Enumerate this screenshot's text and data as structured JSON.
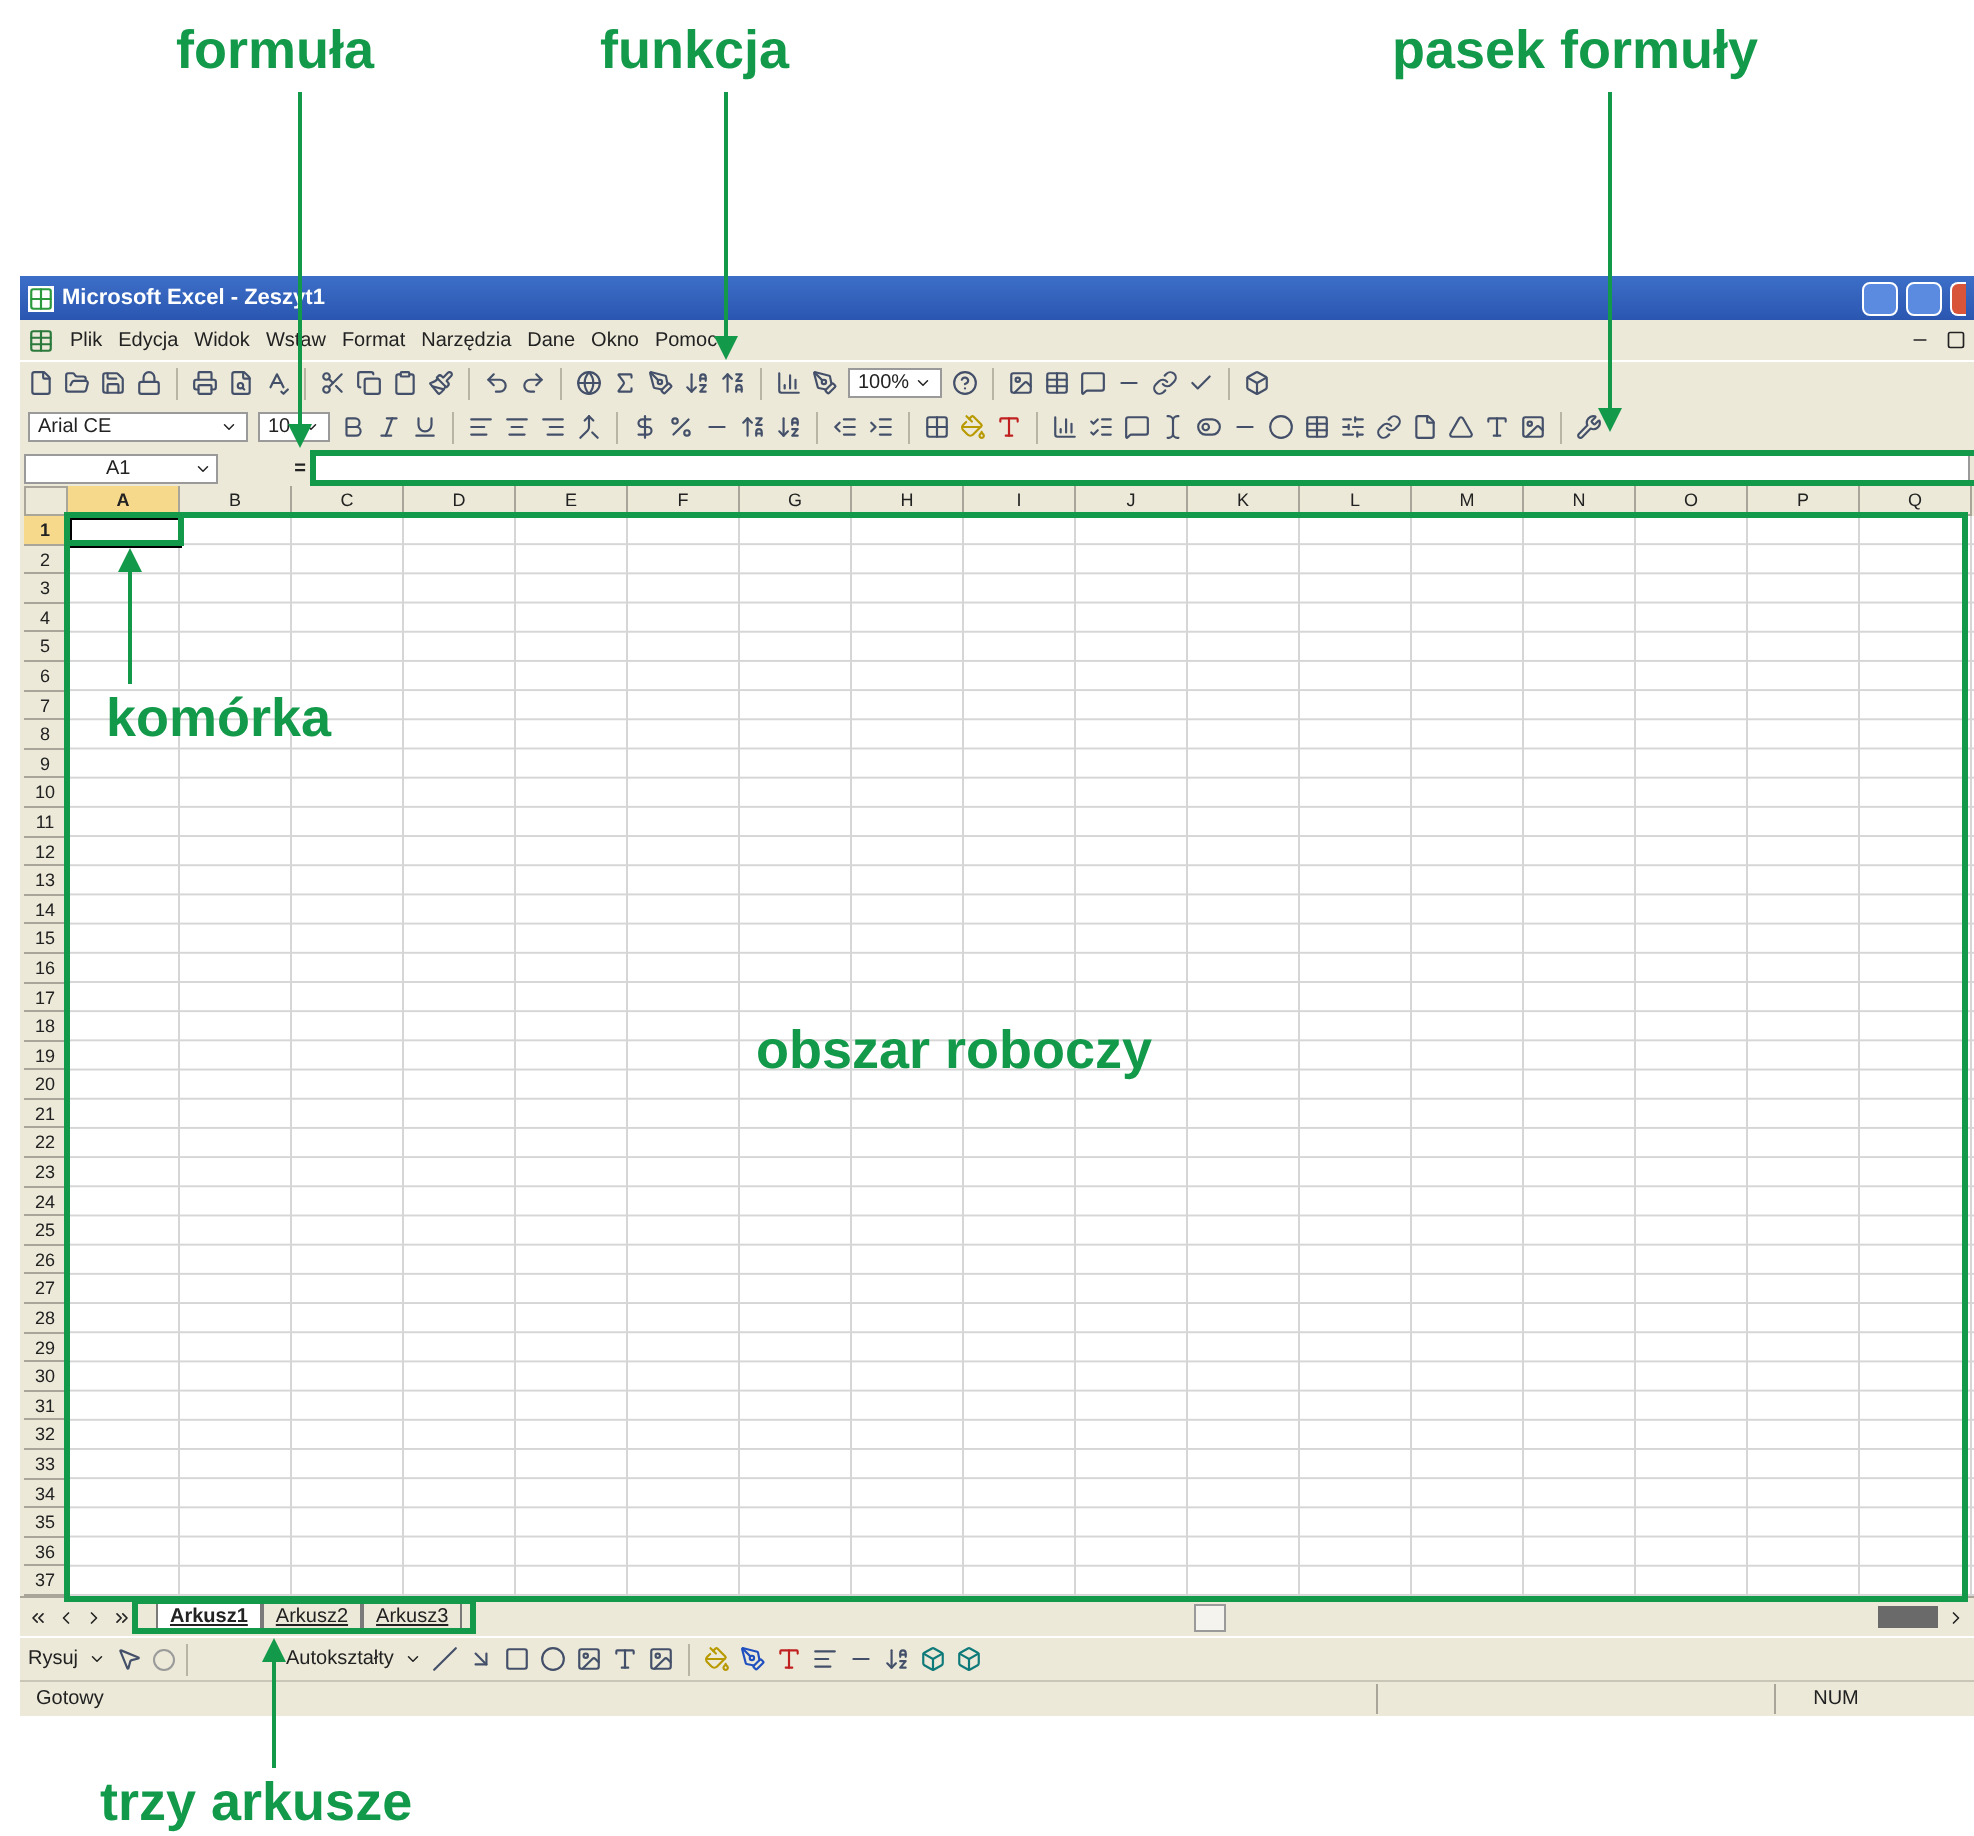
{
  "annotations": [
    {
      "text": "formuła"
    },
    {
      "text": "funkcja"
    },
    {
      "text": "pasek formuły"
    },
    {
      "text": "komórka"
    },
    {
      "text": "obszar roboczy"
    },
    {
      "text": "trzy arkusze"
    }
  ],
  "window": {
    "title": "Microsoft Excel - Zeszyt1"
  },
  "menu": [
    "Plik",
    "Edycja",
    "Widok",
    "Wstaw",
    "Format",
    "Narzędzia",
    "Dane",
    "Okno",
    "Pomoc"
  ],
  "toolbar": {
    "zoom": "100%",
    "font": "Arial CE",
    "font_size": "10"
  },
  "formula_bar": {
    "name_box": "A1",
    "equals": "="
  },
  "columns": [
    {
      "label": "A",
      "selected": true
    },
    {
      "label": "B",
      "selected": false
    },
    {
      "label": "C",
      "selected": false
    },
    {
      "label": "D",
      "selected": false
    },
    {
      "label": "E",
      "selected": false
    },
    {
      "label": "F",
      "selected": false
    },
    {
      "label": "G",
      "selected": false
    },
    {
      "label": "H",
      "selected": false
    },
    {
      "label": "I",
      "selected": false
    },
    {
      "label": "J",
      "selected": false
    },
    {
      "label": "K",
      "selected": false
    },
    {
      "label": "L",
      "selected": false
    },
    {
      "label": "M",
      "selected": false
    },
    {
      "label": "N",
      "selected": false
    },
    {
      "label": "O",
      "selected": false
    },
    {
      "label": "P",
      "selected": false
    },
    {
      "label": "Q",
      "selected": false
    }
  ],
  "rows": [
    {
      "label": "1",
      "selected": true
    },
    {
      "label": "2",
      "selected": false
    },
    {
      "label": "3",
      "selected": false
    },
    {
      "label": "4",
      "selected": false
    },
    {
      "label": "5",
      "selected": false
    },
    {
      "label": "6",
      "selected": false
    },
    {
      "label": "7",
      "selected": false
    },
    {
      "label": "8",
      "selected": false
    },
    {
      "label": "9",
      "selected": false
    },
    {
      "label": "10",
      "selected": false
    },
    {
      "label": "11",
      "selected": false
    },
    {
      "label": "12",
      "selected": false
    },
    {
      "label": "13",
      "selected": false
    },
    {
      "label": "14",
      "selected": false
    },
    {
      "label": "15",
      "selected": false
    },
    {
      "label": "16",
      "selected": false
    },
    {
      "label": "17",
      "selected": false
    },
    {
      "label": "18",
      "selected": false
    },
    {
      "label": "19",
      "selected": false
    },
    {
      "label": "20",
      "selected": false
    },
    {
      "label": "21",
      "selected": false
    },
    {
      "label": "22",
      "selected": false
    },
    {
      "label": "23",
      "selected": false
    },
    {
      "label": "24",
      "selected": false
    },
    {
      "label": "25",
      "selected": false
    },
    {
      "label": "26",
      "selected": false
    },
    {
      "label": "27",
      "selected": false
    },
    {
      "label": "28",
      "selected": false
    },
    {
      "label": "29",
      "selected": false
    },
    {
      "label": "30",
      "selected": false
    },
    {
      "label": "31",
      "selected": false
    },
    {
      "label": "32",
      "selected": false
    },
    {
      "label": "33",
      "selected": false
    },
    {
      "label": "34",
      "selected": false
    },
    {
      "label": "35",
      "selected": false
    },
    {
      "label": "36",
      "selected": false
    },
    {
      "label": "37",
      "selected": false
    }
  ],
  "sheet_tabs": [
    {
      "label": "Arkusz1",
      "selected": true
    },
    {
      "label": "Arkusz2",
      "selected": false
    },
    {
      "label": "Arkusz3",
      "selected": false
    }
  ],
  "drawing_toolbar": {
    "draw": "Rysuj",
    "autoshapes": "Autokształty"
  },
  "status_bar": {
    "status": "Gotowy",
    "indicator": "NUM"
  }
}
